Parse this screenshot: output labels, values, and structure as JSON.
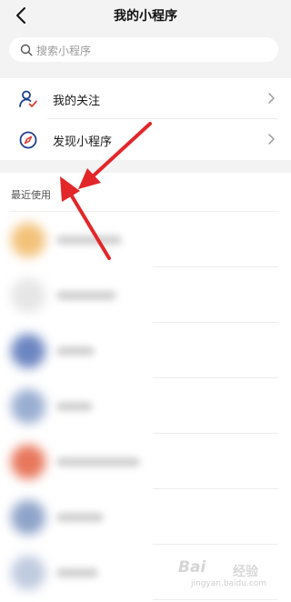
{
  "header": {
    "title": "我的小程序",
    "back_icon": "back-arrow-icon"
  },
  "search": {
    "placeholder": "搜索小程序",
    "icon": "search-icon"
  },
  "menu": {
    "items": [
      {
        "label": "我的关注",
        "icon": "person-check-icon"
      },
      {
        "label": "发现小程序",
        "icon": "compass-icon"
      }
    ]
  },
  "recent": {
    "title": "最近使用",
    "apps": [
      {
        "avatar_color": "#f3c27a"
      },
      {
        "avatar_color": "#e6e6e6"
      },
      {
        "avatar_color": "#6c86c2"
      },
      {
        "avatar_color": "#9aaed2"
      },
      {
        "avatar_color": "#e8775c"
      },
      {
        "avatar_color": "#8fa4c9"
      },
      {
        "avatar_color": "#c0cbe0"
      }
    ]
  },
  "annotation": {
    "arrow_color": "#e3262a"
  },
  "watermark": {
    "brand": "Bai",
    "sub": "经验",
    "url": "jingyan.baidu.com"
  }
}
